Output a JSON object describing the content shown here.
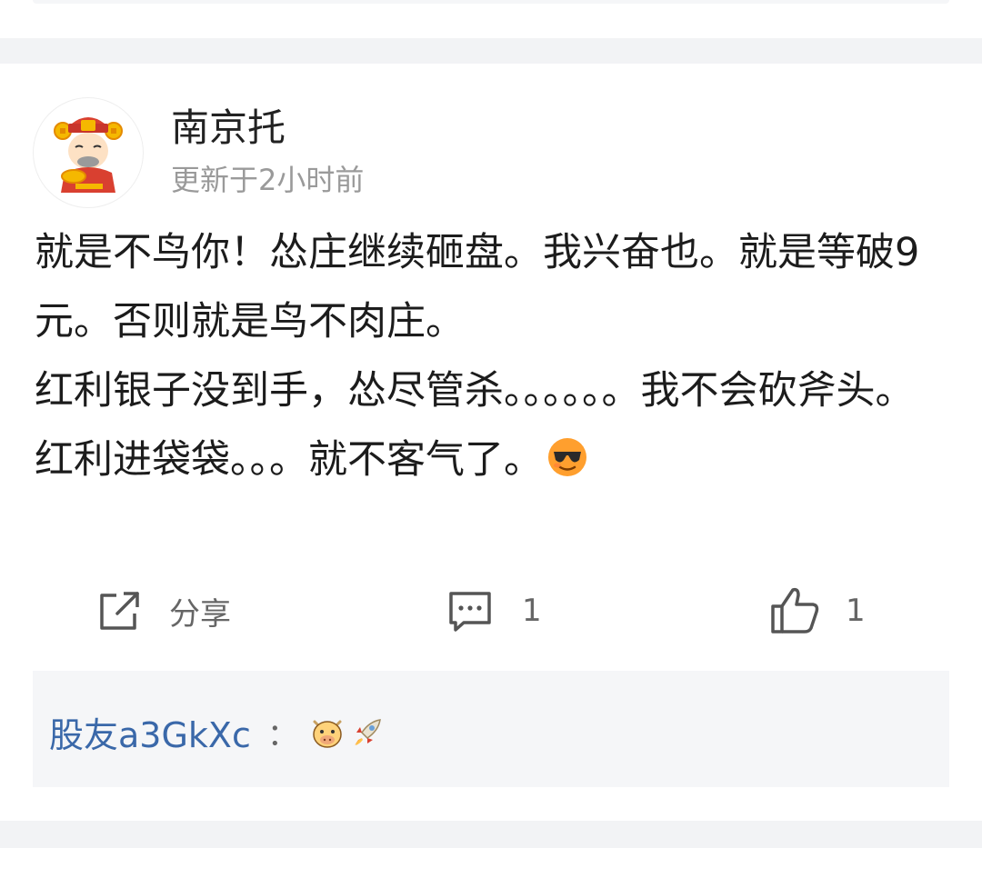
{
  "post": {
    "author": "南京托",
    "time": "更新于2小时前",
    "paragraph1": "就是不鸟你！怂庄继续砸盘。我兴奋也。就是等破9元。否则就是鸟不肉庄。",
    "paragraph2": "红利银子没到手，怂尽管杀。。。。。。我不会砍斧头。红利进袋袋。。。就不客气了。",
    "emoji": "sunglasses-emoji"
  },
  "actions": {
    "share_label": "分享",
    "comment_count": "1",
    "like_count": "1"
  },
  "reply": {
    "user": "股友a3GkXc",
    "separator": "：",
    "emojis": [
      "cow-emoji",
      "rocket-emoji"
    ]
  },
  "colors": {
    "reply_user": "#3a68a9",
    "meta_gray": "#9a9a9a",
    "separator_bg": "#f2f3f5",
    "reply_bg": "#f5f6f8"
  }
}
